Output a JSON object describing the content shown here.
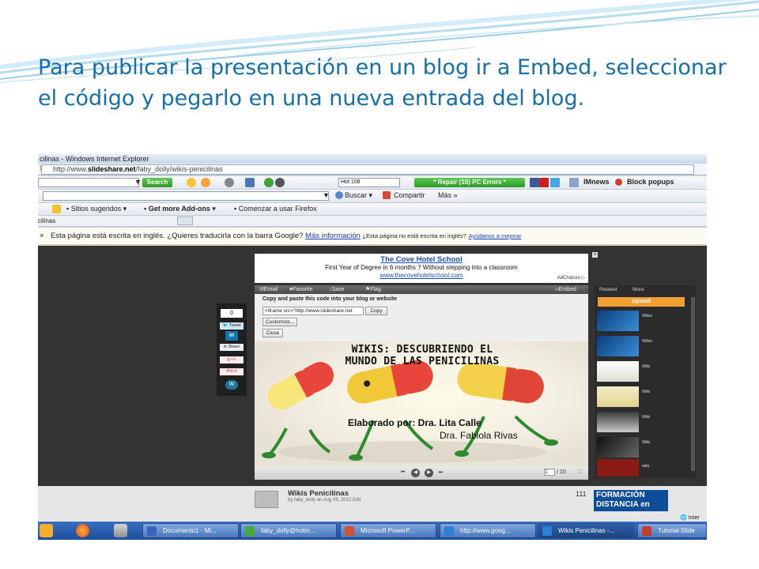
{
  "slide": {
    "title": "Para publicar la presentación en un blog ir a Embed, seleccionar el código y pegarlo en una nueva entrada del blog."
  },
  "browser": {
    "window_title": "cilinas - Windows Internet Explorer",
    "url_prefix": "http://www.",
    "url_domain": "slideshare.net",
    "url_path": "/faby_dolly/wikis-penicilinas"
  },
  "toolbar1": {
    "search_label": "Search",
    "hot_label": "Hot 108",
    "repair_label": "* Repair (15) PC Errors *",
    "imnews_label": "IMnews",
    "block_popups_label": "Block popups"
  },
  "toolbar2": {
    "buscar_label": "Buscar",
    "compartir_label": "Compartir",
    "mas_label": "Más »"
  },
  "favorites": {
    "sitios_label": "Sitios sugeridos",
    "addons_label": "Get more Add-ons",
    "firefox_label": "Comenzar a usar Firefox"
  },
  "tab": {
    "label": "cilinas"
  },
  "translate": {
    "message": "Esta página está escrita en inglés. ¿Quieres traducirla con la barra Google?",
    "more_info": "Más información",
    "not_english": "¿Esta página no está escrita en inglés?",
    "help": "Ayúdanos a mejorar"
  },
  "ad": {
    "title": "The Cove Hotel School",
    "line": "First Year of Degree in 6 months ? Without stepping into a classroom",
    "url": "www.thecovehotelschool.com",
    "choices": "AdChoices ▷",
    "close": "×"
  },
  "player_bar": {
    "email": "Email",
    "favorite": "Favorite",
    "save_file": "Save file",
    "flag": "Flag",
    "embed": "Embed"
  },
  "embed": {
    "instruction": "Copy and paste this code into your blog or website",
    "code": "<iframe src=\"http://www.slideshare.net",
    "copy": "Copy",
    "customize": "Customize...",
    "close": "Close"
  },
  "share": {
    "count": "0",
    "tweet": "Tweet",
    "linkedin_share": "Share",
    "gplus": "+1",
    "pinit": "Pin it"
  },
  "slide_content": {
    "heading_line1": "WIKIS: DESCUBRIENDO EL",
    "heading_line2": "MUNDO DE LAS PENICILINAS",
    "author_line1": "Elaborado por: Dra. Lita Calle",
    "author_line2": "Dra. Fabiola Rivas"
  },
  "slide_nav": {
    "page": "1",
    "total": "10"
  },
  "related": {
    "tab_related": "Related",
    "tab_more": "More",
    "upload": "Upload",
    "items": [
      "Wikis",
      "Wikis",
      "Wiki",
      "Wiki",
      "Wiki",
      "Wiki",
      "wiki"
    ]
  },
  "info": {
    "presentation_name": "Wikis Penicilinas",
    "meta": "by faby_dolly on Aug 05, 2012 Edit",
    "views": "111",
    "formacion_line1": "FORMACIÓN",
    "formacion_line2": "DISTANCIA en",
    "status_right": "Inter"
  },
  "taskbar": {
    "tasks": [
      "Documento1 - Mi...",
      "faby_dolly@hotm...",
      "Microsoft PowerP...",
      "http://www.goog...",
      "Wikis Penicilinas -...",
      "Tutorial-Slide"
    ]
  },
  "colors": {
    "title_blue": "#156fa8",
    "viewer_bg": "#333333",
    "repair_green": "#2d9a29",
    "upload_orange": "#f0a030",
    "taskbar_blue": "#1c4e9a"
  }
}
